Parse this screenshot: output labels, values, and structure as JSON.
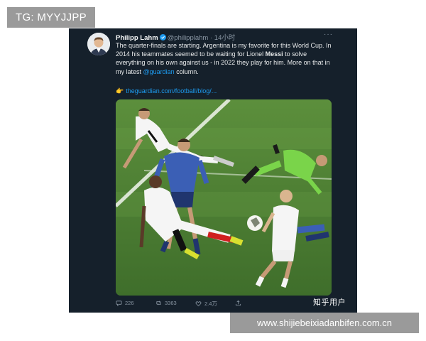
{
  "watermark_top": "TG: MYYJJPP",
  "watermark_bottom": "www.shijiebeixiadanbifen.com.cn",
  "tweet": {
    "author_name": "Philipp Lahm",
    "verified_icon": "verified-badge-icon",
    "handle": "@philipplahm",
    "separator": "·",
    "time": "14小时",
    "more_label": "···",
    "text_part1": "The quarter-finals are starting. Argentina is my favorite for this World Cup. In 2014 his teammates seemed to be waiting for Lionel ",
    "text_bold": "Messi",
    "text_part2": " to solve everything on his own against us - in 2022 they play for him. More on that in my latest ",
    "text_mention": "@guardian",
    "text_part3": " column.",
    "link_emoji": "👉",
    "link_text": "theguardian.com/football/blog/...",
    "stats": {
      "replies": "226",
      "retweets": "3363",
      "likes": "2.4万"
    }
  },
  "photo_watermark": "知乎用户",
  "colors": {
    "card_bg": "#15202b",
    "link": "#1d9bf0",
    "muted": "#8b98a5",
    "pitch": "#4f8236"
  }
}
